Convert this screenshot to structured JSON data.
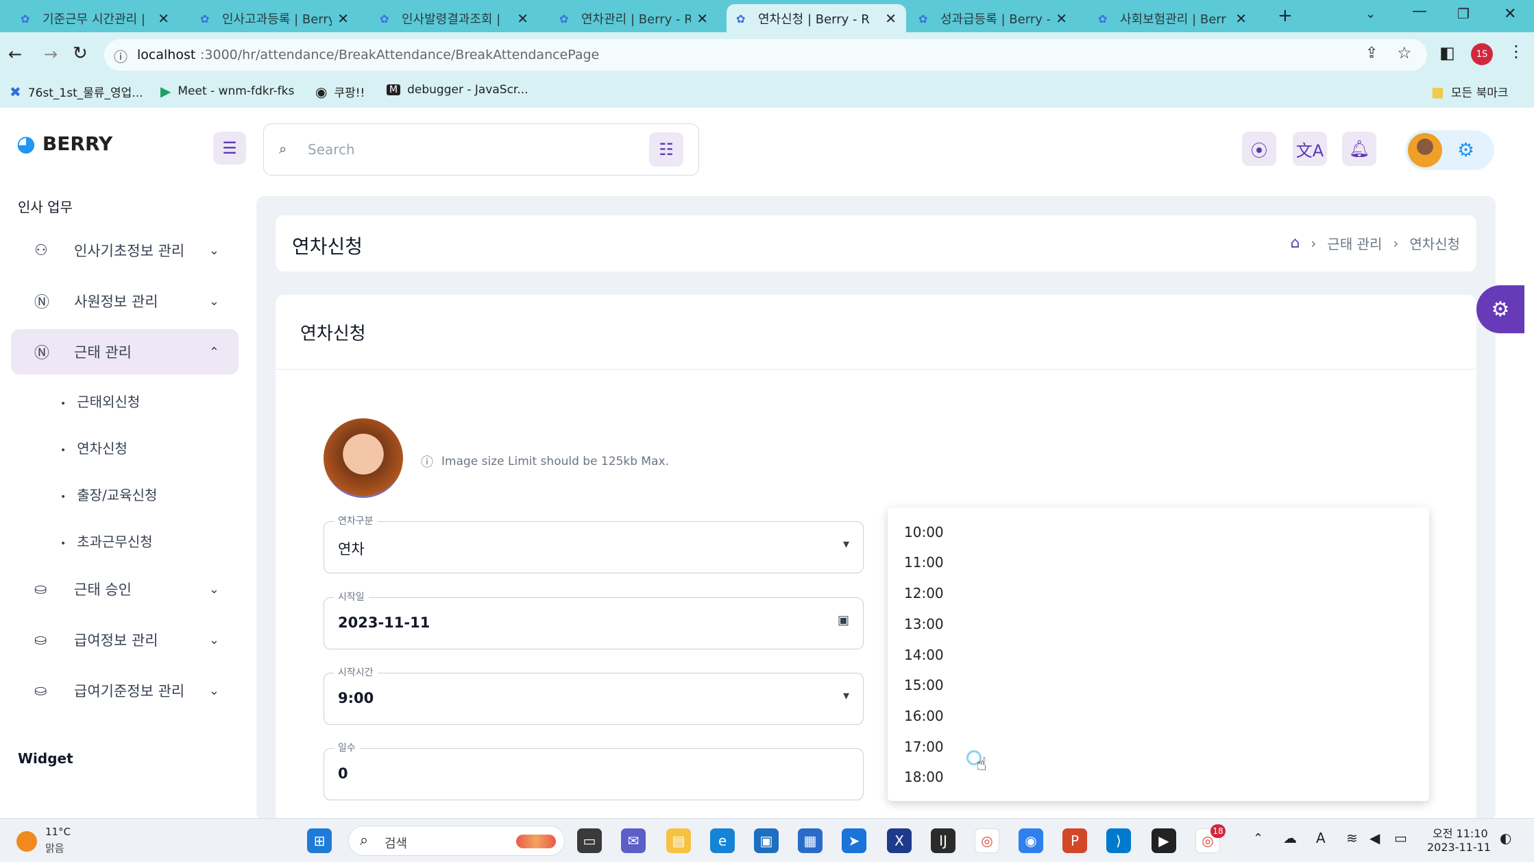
{
  "browser": {
    "tabs": [
      {
        "title": "기준근무 시간관리 |",
        "active": false
      },
      {
        "title": "인사고과등록 | Berry",
        "active": false
      },
      {
        "title": "인사발령결과조회 | ",
        "active": false
      },
      {
        "title": "연차관리 | Berry - R",
        "active": false
      },
      {
        "title": "연차신청 | Berry - R",
        "active": true
      },
      {
        "title": "성과급등록 | Berry -",
        "active": false
      },
      {
        "title": "사회보험관리 | Berr",
        "active": false
      }
    ],
    "new_tab": "+",
    "url_host": "localhost",
    "url_path": ":3000/hr/attendance/BreakAttendance/BreakAttendancePage",
    "profile_initial": "1S",
    "bookmarks": [
      {
        "label": "76st_1st_물류_영업...",
        "icon": "x-logo-icon"
      },
      {
        "label": "Meet - wnm-fdkr-fks",
        "icon": "meet-icon"
      },
      {
        "label": "쿠팡!!",
        "icon": "globe-icon"
      },
      {
        "label": "debugger - JavaScr...",
        "icon": "m-logo-icon"
      }
    ],
    "all_bookmarks": "모든 북마크"
  },
  "app": {
    "logo_text": "BERRY",
    "search_placeholder": "Search",
    "accent": "#673ab7"
  },
  "sidebar": {
    "section_title": "인사 업무",
    "items": [
      {
        "label": "인사기초정보 관리",
        "expanded": false
      },
      {
        "label": "사원정보 관리",
        "expanded": false
      },
      {
        "label": "근태 관리",
        "expanded": true,
        "active": true
      },
      {
        "label": "근태 승인",
        "expanded": false
      },
      {
        "label": "급여정보 관리",
        "expanded": false
      },
      {
        "label": "급여기준정보 관리",
        "expanded": false
      }
    ],
    "subitems": [
      "근태외신청",
      "연차신청",
      "출장/교육신청",
      "초과근무신청"
    ],
    "widget_title": "Widget"
  },
  "page": {
    "title": "연차신청",
    "breadcrumb": [
      "근태 관리",
      "연차신청"
    ],
    "card_title": "연차신청",
    "image_hint": "Image size Limit should be 125kb Max."
  },
  "form": {
    "type": {
      "label": "연차구분",
      "value": "연차"
    },
    "start_date": {
      "label": "시작일",
      "value": "2023-11-11"
    },
    "start_time": {
      "label": "시작시간",
      "value": "9:00"
    },
    "days": {
      "label": "일수",
      "value": "0"
    }
  },
  "time_options": [
    "10:00",
    "11:00",
    "12:00",
    "13:00",
    "14:00",
    "15:00",
    "16:00",
    "17:00",
    "18:00"
  ],
  "taskbar": {
    "weather_temp": "11°C",
    "weather_desc": "맑음",
    "search_label": "검색",
    "time": "오전 11:10",
    "date": "2023-11-11",
    "chrome_badge": "18"
  }
}
